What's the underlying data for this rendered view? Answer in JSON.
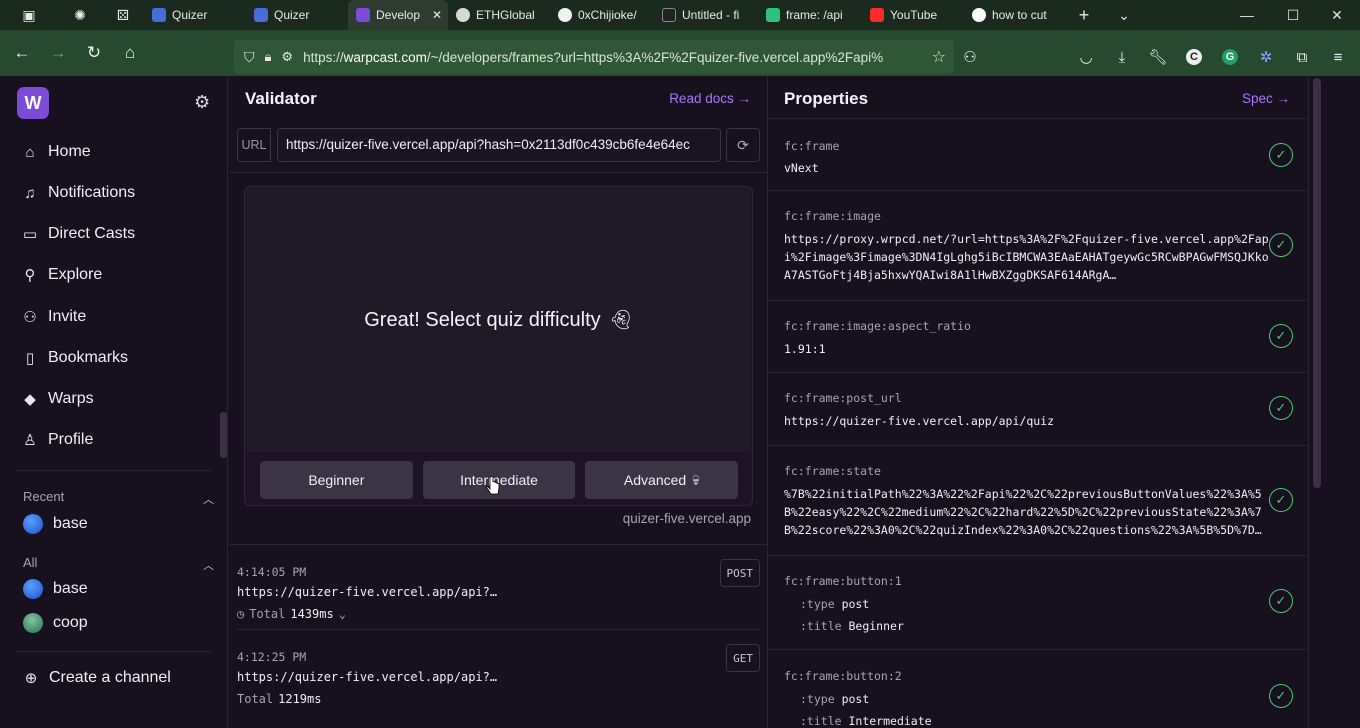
{
  "browser": {
    "tabs": [
      {
        "label": "Quizer",
        "color": "#4a6cd8"
      },
      {
        "label": "Quizer",
        "color": "#4a6cd8"
      },
      {
        "label": "Develop",
        "color": "#7c4cd8",
        "active": true
      },
      {
        "label": "ETHGlobal",
        "color": "#d8d8d8"
      },
      {
        "label": "0xChijioke/",
        "color": "#f0f0f0"
      },
      {
        "label": "Untitled - fi",
        "color": "#222222"
      },
      {
        "label": "frame: /api",
        "color": "#2ec27e"
      },
      {
        "label": "YouTube",
        "color": "#ff2a2a"
      },
      {
        "label": "how to cut",
        "color": "#ffffff"
      }
    ],
    "url_prefix": "https://",
    "url_host": "warpcast.com",
    "url_rest": "/~/developers/frames?url=https%3A%2F%2Fquizer-five.vercel.app%2Fapi%"
  },
  "sidebar": {
    "logo": "W",
    "nav": [
      {
        "label": "Home",
        "icon": "home-icon"
      },
      {
        "label": "Notifications",
        "icon": "bell-icon"
      },
      {
        "label": "Direct Casts",
        "icon": "chat-icon"
      },
      {
        "label": "Explore",
        "icon": "search-icon"
      },
      {
        "label": "Invite",
        "icon": "users-icon"
      },
      {
        "label": "Bookmarks",
        "icon": "bookmark-icon"
      },
      {
        "label": "Warps",
        "icon": "diamond-icon"
      },
      {
        "label": "Profile",
        "icon": "user-icon"
      }
    ],
    "recent_label": "Recent",
    "recent_channels": [
      "base"
    ],
    "all_label": "All",
    "all_channels": [
      "base",
      "coop"
    ],
    "create_channel": "Create a channel"
  },
  "validator": {
    "title": "Validator",
    "read_docs": "Read docs",
    "url_label": "URL",
    "url_value": "https://quizer-five.vercel.app/api?hash=0x2113df0c439cb6fe4e64ec",
    "frame_text": "Great! Select quiz difficulty",
    "buttons": [
      "Beginner",
      "Intermediate",
      "Advanced"
    ],
    "domain": "quizer-five.vercel.app",
    "logs": [
      {
        "time": "4:14:05 PM",
        "url": "https://quizer-five.vercel.app/api?…",
        "total_label": "Total",
        "total": "1439ms",
        "method": "POST"
      },
      {
        "time": "4:12:25 PM",
        "url": "https://quizer-five.vercel.app/api?…",
        "total_label": "Total",
        "total": "1219ms",
        "method": "GET"
      }
    ]
  },
  "properties": {
    "title": "Properties",
    "spec": "Spec",
    "rows": [
      {
        "key": "fc:frame",
        "value": "vNext"
      },
      {
        "key": "fc:frame:image",
        "value": "https://proxy.wrpcd.net/?url=https%3A%2F%2Fquizer-five.vercel.app%2Fapi%2Fimage%3Fimage%3DN4IgLghg5iBcIBMCWA3EAaEAHATgeywGc5RCwBPAGwFMSQJKkoA7ASTGoFtj4Bja5hxwYQAIwi8A1lHwBXZggDKSAF614ARgA…"
      },
      {
        "key": "fc:frame:image:aspect_ratio",
        "value": "1.91:1"
      },
      {
        "key": "fc:frame:post_url",
        "value": "https://quizer-five.vercel.app/api/quiz"
      },
      {
        "key": "fc:frame:state",
        "value": "%7B%22initialPath%22%3A%22%2Fapi%22%2C%22previousButtonValues%22%3A%5B%22easy%22%2C%22medium%22%2C%22hard%22%5D%2C%22previousState%22%3A%7B%22score%22%3A0%2C%22quizIndex%22%3A0%2C%22questions%22%3A%5B%5D%7D…"
      },
      {
        "key": "fc:frame:button:1",
        "type_label": ":type",
        "type": "post",
        "title_label": ":title",
        "title": "Beginner"
      },
      {
        "key": "fc:frame:button:2",
        "type_label": ":type",
        "type": "post",
        "title_label": ":title",
        "title": "Intermediate"
      }
    ]
  }
}
